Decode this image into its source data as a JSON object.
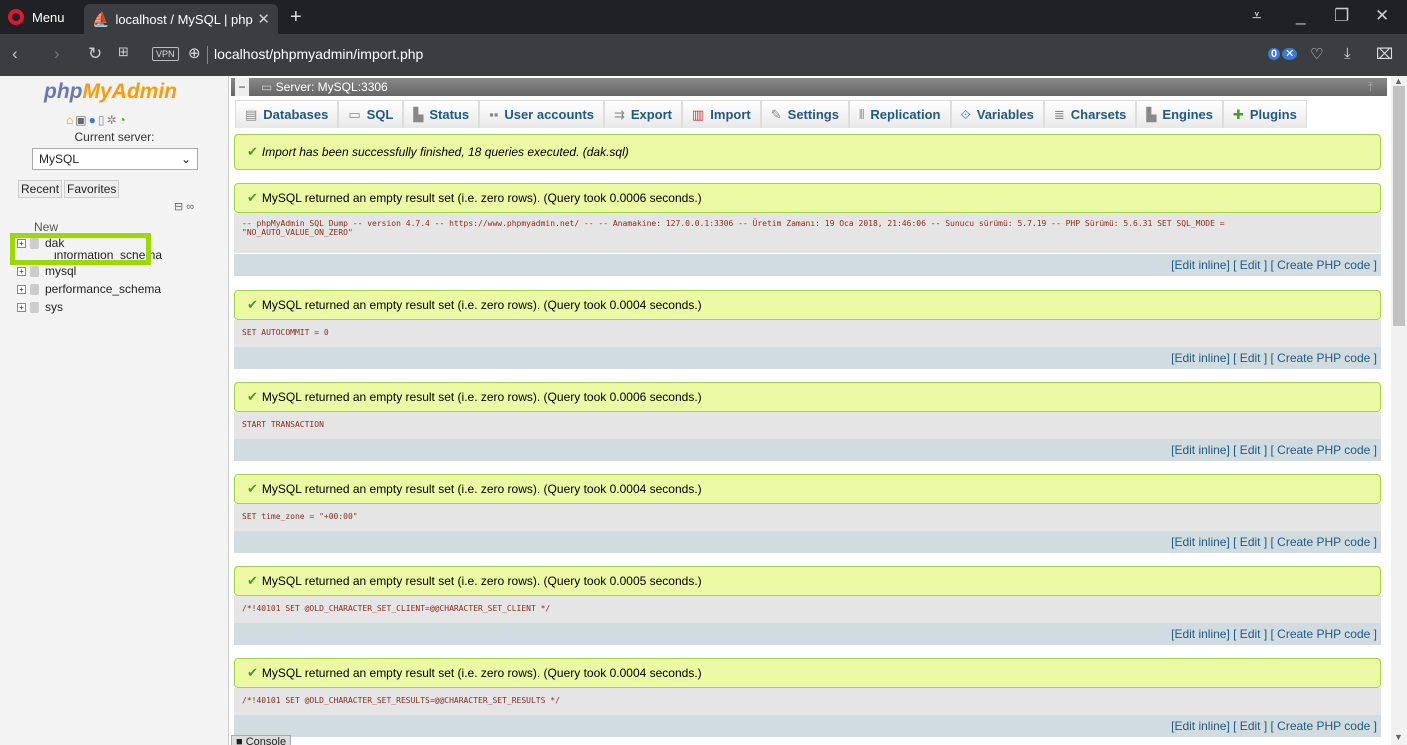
{
  "browser": {
    "menu_label": "Menu",
    "tab_title": "localhost / MySQL | phpM",
    "url": "localhost/phpmyadmin/import.php",
    "vpn_label": "VPN",
    "badge_count": "0"
  },
  "nav": {
    "logo_php": "php",
    "logo_myadmin": "MyAdmin",
    "current_server_label": "Current server:",
    "server_value": "MySQL",
    "recent_label": "Recent",
    "favorites_label": "Favorites",
    "tree": [
      {
        "label": "New"
      },
      {
        "label": "dak"
      },
      {
        "label": "information_schema"
      },
      {
        "label": "mysql"
      },
      {
        "label": "performance_schema"
      },
      {
        "label": "sys"
      }
    ]
  },
  "server_bar": {
    "label": "Server: MySQL:3306"
  },
  "tabs": [
    {
      "label": "Databases",
      "icon": "database-icon"
    },
    {
      "label": "SQL",
      "icon": "sql-icon"
    },
    {
      "label": "Status",
      "icon": "status-icon"
    },
    {
      "label": "User accounts",
      "icon": "users-icon"
    },
    {
      "label": "Export",
      "icon": "export-icon"
    },
    {
      "label": "Import",
      "icon": "import-icon"
    },
    {
      "label": "Settings",
      "icon": "settings-icon"
    },
    {
      "label": "Replication",
      "icon": "replication-icon"
    },
    {
      "label": "Variables",
      "icon": "variables-icon"
    },
    {
      "label": "Charsets",
      "icon": "charsets-icon"
    },
    {
      "label": "Engines",
      "icon": "engines-icon"
    },
    {
      "label": "Plugins",
      "icon": "plugins-icon"
    }
  ],
  "import_message": "Import has been successfully finished, 18 queries executed. (dak.sql)",
  "results": [
    {
      "message": "MySQL returned an empty result set (i.e. zero rows). (Query took 0.0006 seconds.)",
      "sql": [
        "-- phpMyAdmin SQL Dump -- version 4.7.4 -- https://www.phpmyadmin.net/ -- -- Anamakine: 127.0.0.1:3306 -- Üretim Zamanı: 19 Oca 2018, 21:46:06 -- Sunucu sürümü: 5.7.19 -- PHP Sürümü: 5.6.31 SET SQL_MODE =",
        "\"NO_AUTO_VALUE_ON_ZERO\""
      ]
    },
    {
      "message": "MySQL returned an empty result set (i.e. zero rows). (Query took 0.0004 seconds.)",
      "sql": [
        "SET AUTOCOMMIT = 0"
      ]
    },
    {
      "message": "MySQL returned an empty result set (i.e. zero rows). (Query took 0.0006 seconds.)",
      "sql": [
        "START TRANSACTION"
      ]
    },
    {
      "message": "MySQL returned an empty result set (i.e. zero rows). (Query took 0.0004 seconds.)",
      "sql": [
        "SET time_zone = \"+00:00\""
      ]
    },
    {
      "message": "MySQL returned an empty result set (i.e. zero rows). (Query took 0.0005 seconds.)",
      "sql": [
        "/*!40101 SET @OLD_CHARACTER_SET_CLIENT=@@CHARACTER_SET_CLIENT */"
      ]
    },
    {
      "message": "MySQL returned an empty result set (i.e. zero rows). (Query took 0.0004 seconds.)",
      "sql": [
        "/*!40101 SET @OLD_CHARACTER_SET_RESULTS=@@CHARACTER_SET_RESULTS */"
      ]
    }
  ],
  "result_links": "[Edit inline] [ Edit ] [ Create PHP code ]",
  "console_label": "Console",
  "colors": {
    "success_bg": "#ebf8a4",
    "success_border": "#a2d246",
    "highlight": "#9cd900",
    "link": "#235a81"
  }
}
